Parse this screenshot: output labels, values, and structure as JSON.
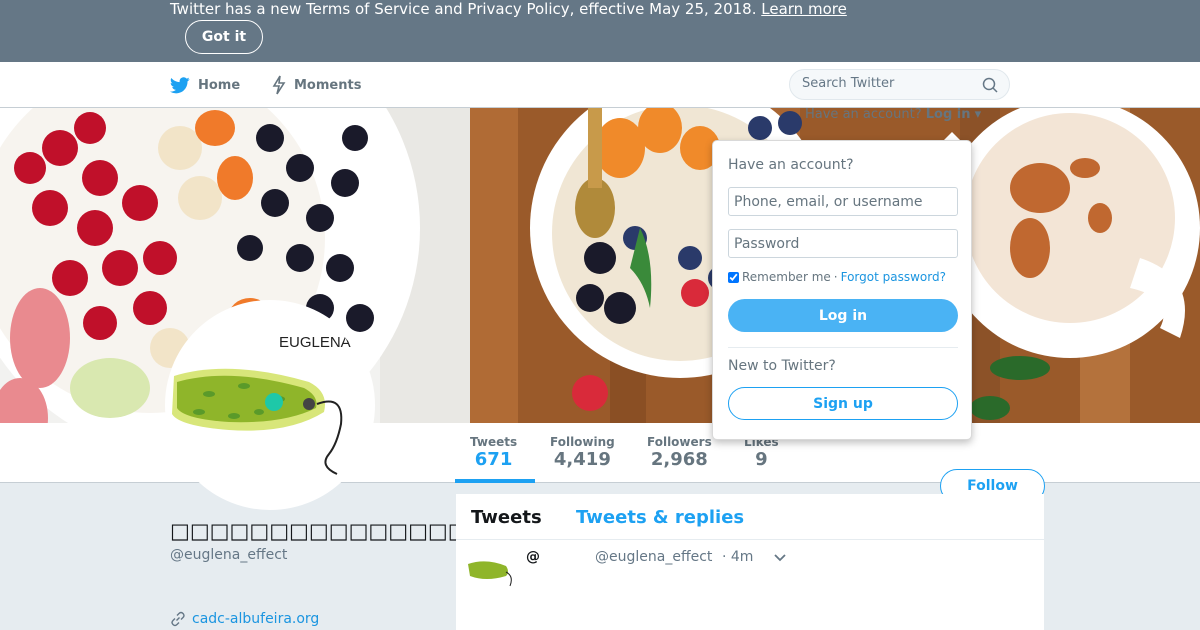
{
  "banner": {
    "text": "Twitter has a new Terms of Service and Privacy Policy, effective May 25, 2018.",
    "learn_more": "Learn more",
    "got_it": "Got it"
  },
  "nav": {
    "home": "Home",
    "moments": "Moments",
    "search_placeholder": "Search Twitter",
    "have_account": "Have an account?",
    "log_in": "Log in"
  },
  "login_dropdown": {
    "title": "Have an account?",
    "username_placeholder": "Phone, email, or username",
    "password_placeholder": "Password",
    "remember_me": "Remember me",
    "separator": "·",
    "forgot_password": "Forgot password?",
    "login_button": "Log in",
    "new_to_twitter": "New to Twitter?",
    "signup_button": "Sign up"
  },
  "stats": [
    {
      "label": "Tweets",
      "value": "671",
      "active": true
    },
    {
      "label": "Following",
      "value": "4,419",
      "active": false
    },
    {
      "label": "Followers",
      "value": "2,968",
      "active": false
    },
    {
      "label": "Likes",
      "value": "9",
      "active": false
    }
  ],
  "follow_button": "Follow",
  "profile": {
    "avatar_text": "EUGLENA",
    "name": "□□□□□□□□□□□□□□□□@□□",
    "handle": "@euglena_effect",
    "website": "cadc-albufeira.org"
  },
  "timeline": {
    "tabs": [
      "Tweets",
      "Tweets & replies"
    ],
    "tweet": {
      "name": "@",
      "handle": "@euglena_effect",
      "time": "· 4m"
    }
  },
  "colors": {
    "twitter_blue": "#1da1f2",
    "banner_gray": "#657786",
    "page_bg": "#e6ecf0"
  }
}
